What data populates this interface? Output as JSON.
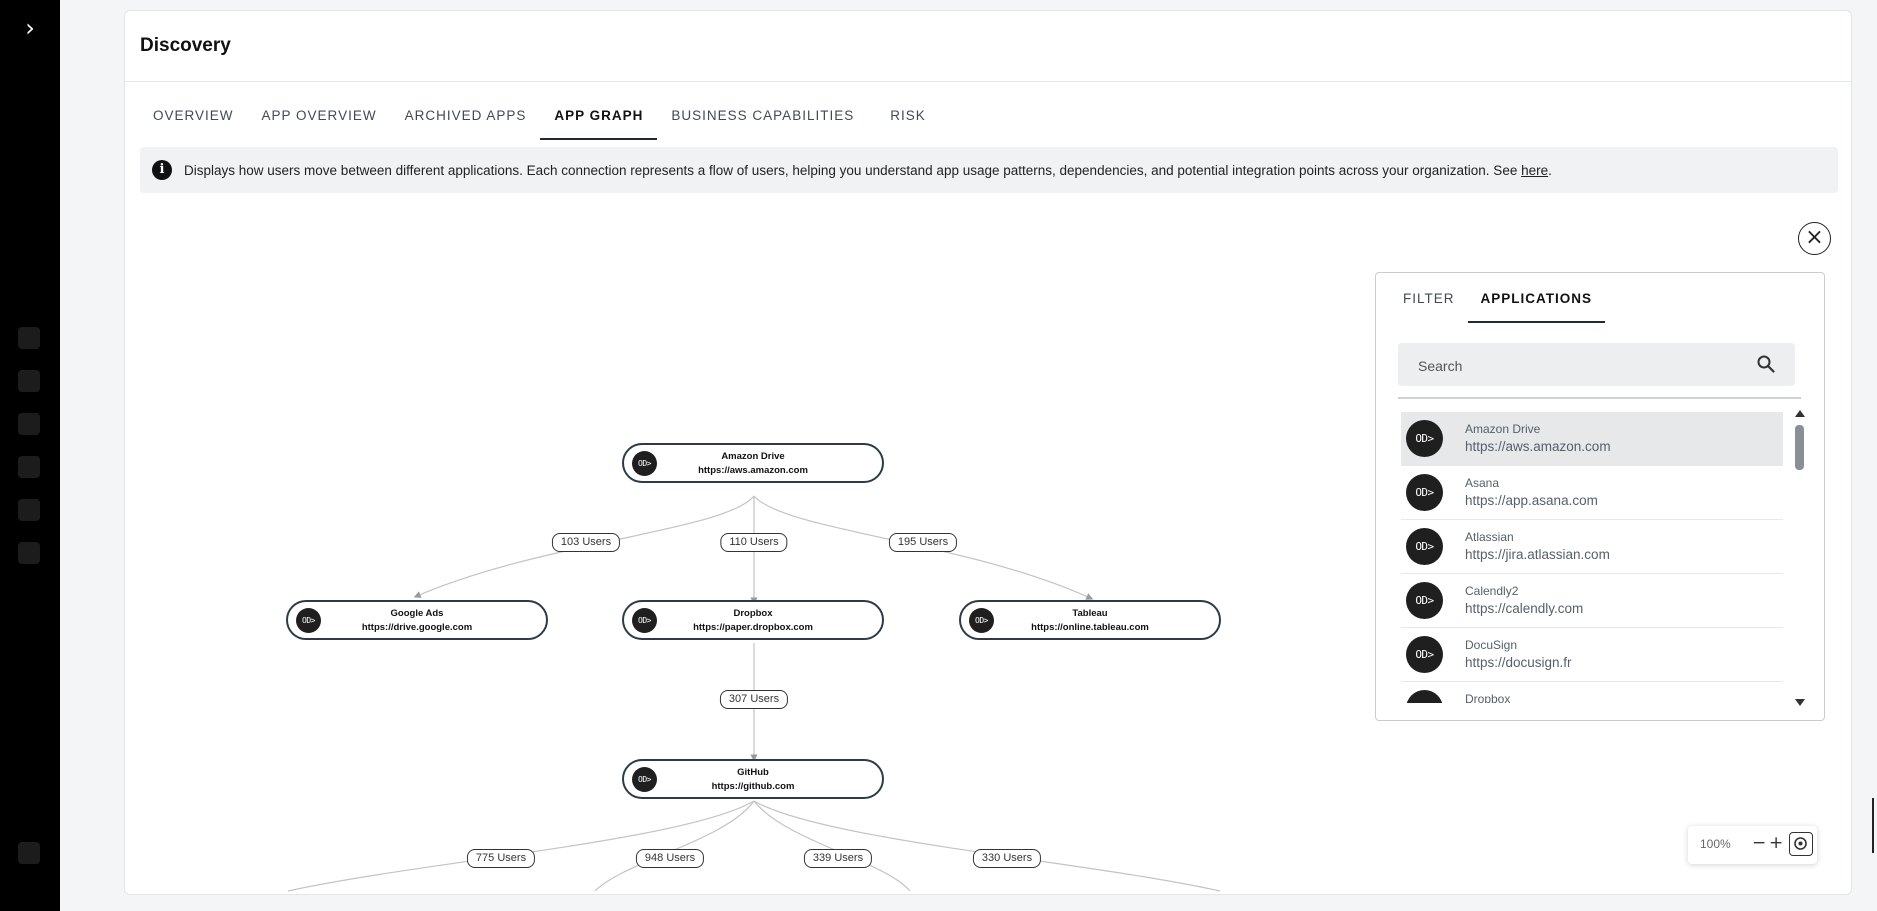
{
  "sidebar": {
    "toggle_icon": "chevron-right-icon"
  },
  "header": {
    "title": "Discovery"
  },
  "tabs": [
    {
      "label": "OVERVIEW",
      "active": false
    },
    {
      "label": "APP OVERVIEW",
      "active": false
    },
    {
      "label": "ARCHIVED APPS",
      "active": false
    },
    {
      "label": "APP GRAPH",
      "active": true
    },
    {
      "label": "BUSINESS CAPABILITIES",
      "active": false
    },
    {
      "label": "RISK",
      "active": false
    }
  ],
  "info_banner": {
    "icon": "info-icon",
    "text": "Displays how users move between different applications. Each connection represents a flow of users, helping you understand app usage patterns, dependencies, and potential integration points across your organization. See ",
    "link_text": "here",
    "suffix": "."
  },
  "graph": {
    "icon_glyph": "OD>",
    "nodes": {
      "amazon_drive": {
        "name": "Amazon Drive",
        "url": "https://aws.amazon.com"
      },
      "google_ads": {
        "name": "Google Ads",
        "url": "https://drive.google.com"
      },
      "dropbox": {
        "name": "Dropbox",
        "url": "https://paper.dropbox.com"
      },
      "tableau": {
        "name": "Tableau",
        "url": "https://online.tableau.com"
      },
      "github": {
        "name": "GitHub",
        "url": "https://github.com"
      }
    },
    "edges": [
      {
        "from": "Amazon Drive",
        "to": "Google Ads",
        "label": "103 Users"
      },
      {
        "from": "Amazon Drive",
        "to": "Dropbox",
        "label": "110 Users"
      },
      {
        "from": "Amazon Drive",
        "to": "Tableau",
        "label": "195 Users"
      },
      {
        "from": "Dropbox",
        "to": "GitHub",
        "label": "307 Users"
      },
      {
        "from": "GitHub",
        "to": "",
        "label": "775 Users"
      },
      {
        "from": "GitHub",
        "to": "",
        "label": "948 Users"
      },
      {
        "from": "GitHub",
        "to": "",
        "label": "339 Users"
      },
      {
        "from": "GitHub",
        "to": "",
        "label": "330 Users"
      }
    ]
  },
  "panel": {
    "tabs": [
      {
        "label": "FILTER",
        "active": false
      },
      {
        "label": "APPLICATIONS",
        "active": true
      }
    ],
    "search": {
      "placeholder": "Search",
      "value": ""
    },
    "applications": [
      {
        "name": "Amazon Drive",
        "url": "https://aws.amazon.com",
        "selected": true
      },
      {
        "name": "Asana",
        "url": "https://app.asana.com",
        "selected": false
      },
      {
        "name": "Atlassian",
        "url": "https://jira.atlassian.com",
        "selected": false
      },
      {
        "name": "Calendly2",
        "url": "https://calendly.com",
        "selected": false
      },
      {
        "name": "DocuSign",
        "url": "https://docusign.fr",
        "selected": false
      },
      {
        "name": "Dropbox",
        "url": "",
        "selected": false
      }
    ]
  },
  "zoom": {
    "level": "100%",
    "out": "−",
    "in": "+"
  },
  "colors": {
    "rail": "#000000",
    "node_border": "#2e3b47",
    "icon_bg": "#1f1f1f",
    "selected_row": "#e7e8ea"
  }
}
